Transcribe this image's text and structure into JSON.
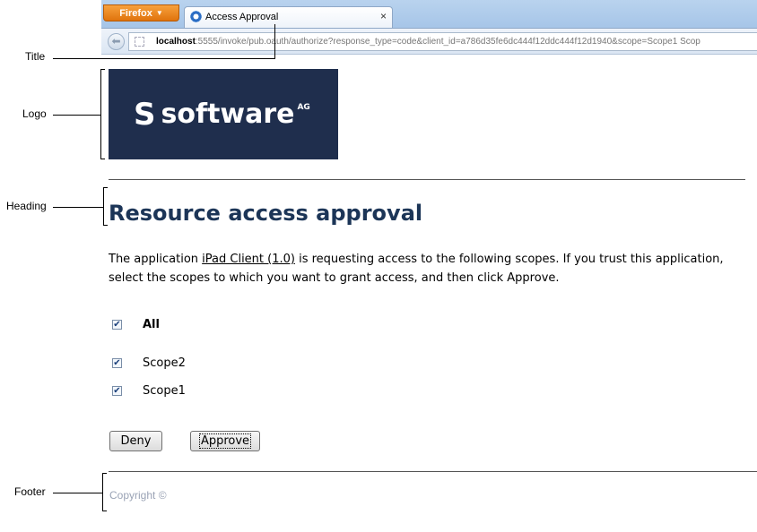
{
  "browser": {
    "app_button": "Firefox",
    "tab_title": "Access Approval",
    "tab_close": "×",
    "url_host": "localhost",
    "url_rest": ":5555/invoke/pub.oauth/authorize?response_type=code&client_id=a786d35fe6dc444f12ddc444f12d1940&scope=Scope1 Scop"
  },
  "callouts": {
    "title": "Title",
    "logo": "Logo",
    "heading": "Heading",
    "footer": "Footer"
  },
  "logo": {
    "mark": "S",
    "word": "software",
    "suffix": "AG"
  },
  "page": {
    "heading": "Resource access approval",
    "intro_before": "The application ",
    "app_link": "iPad Client (1.0)",
    "intro_after": " is requesting access to the following scopes. If you trust this application, select the scopes to which you want to grant access, and then click Approve.",
    "scopes": [
      {
        "label": "All",
        "checked": true
      },
      {
        "label": "Scope2",
        "checked": true
      },
      {
        "label": "Scope1",
        "checked": true
      }
    ],
    "deny_label": "Deny",
    "approve_label": "Approve",
    "footer": "Copyright ©"
  },
  "colors": {
    "logo_bg": "#1f2e4d",
    "heading": "#1c3557",
    "footer_text": "#9aa3b5",
    "firefox_button": "#e8820e"
  }
}
